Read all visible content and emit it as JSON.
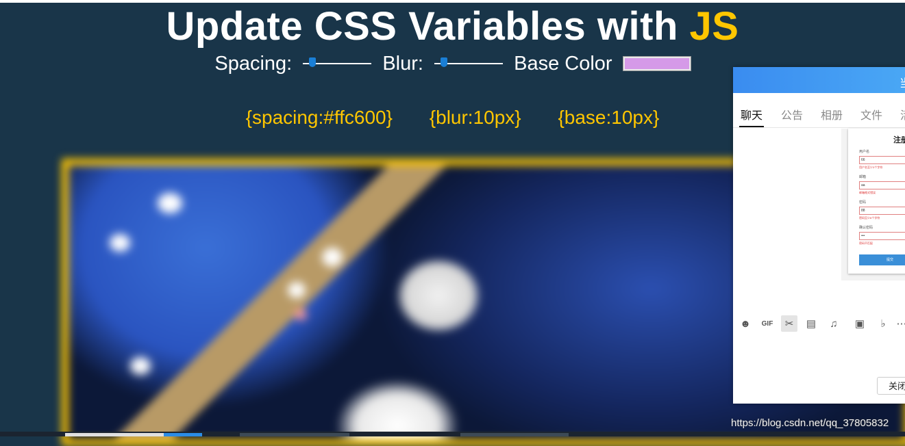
{
  "title": {
    "main": "Update CSS Variables with ",
    "highlight": "JS"
  },
  "controls": {
    "spacing_label": "Spacing:",
    "blur_label": "Blur:",
    "base_label": "Base Color",
    "base_color": "#d59ae8",
    "spacing_value": 0.1,
    "blur_value": 0.1
  },
  "vars": [
    "{spacing:#ffc600}",
    "{blur:10px}",
    "{base:10px}"
  ],
  "colors": {
    "accent": "#ffc600",
    "background": "#193549"
  },
  "dialog": {
    "title_partial": "当",
    "tabs": [
      "聊天",
      "公告",
      "相册",
      "文件",
      "活"
    ],
    "active_tab": "聊天",
    "form": {
      "title": "注册",
      "fields": [
        {
          "label": "用户名",
          "value": "66",
          "error": "用户名至少3个字符"
        },
        {
          "label": "邮箱",
          "value": "aa",
          "error": "邮箱格式错误"
        },
        {
          "label": "密码",
          "value": "88",
          "error": "密码至少6个字符"
        },
        {
          "label": "确认密码",
          "value": "•••",
          "error": "密码不匹配"
        }
      ],
      "submit": "提交"
    },
    "tools": [
      "emoji-icon",
      "gif-icon",
      "scissors-icon",
      "folder-icon",
      "music-icon",
      "image-icon",
      "bell-icon",
      "more-icon"
    ],
    "close_label": "关闭"
  },
  "watermark": "https://blog.csdn.net/qq_37805832"
}
